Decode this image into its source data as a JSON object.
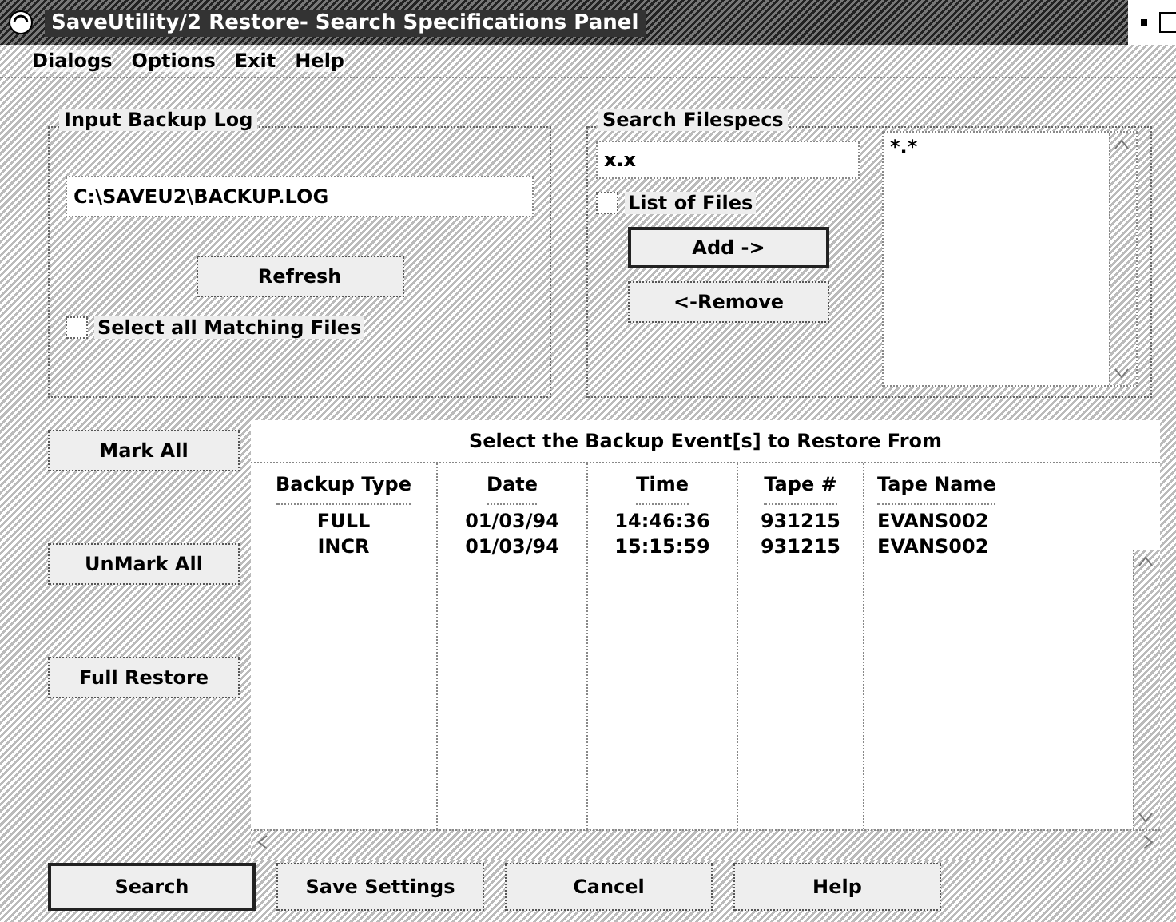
{
  "window": {
    "title": "SaveUtility/2 Restore- Search Specifications Panel"
  },
  "menu": [
    {
      "label": "Dialogs"
    },
    {
      "label": "Options"
    },
    {
      "label": "Exit"
    },
    {
      "label": "Help"
    }
  ],
  "input_backup_log": {
    "title": "Input Backup Log",
    "value": "C:\\SAVEU2\\BACKUP.LOG",
    "refresh_button": "Refresh",
    "select_all": {
      "label": "Select all Matching Files",
      "checked": false
    }
  },
  "search_filespecs": {
    "title": "Search Filespecs",
    "value": "x.x",
    "list_of_files": {
      "label": "List of Files",
      "checked": false
    },
    "add_button": "Add ->",
    "remove_button": "<-Remove",
    "list_items": [
      "*.*"
    ]
  },
  "side_buttons": [
    "Mark All",
    "UnMark All",
    "Full Restore"
  ],
  "table": {
    "title": "Select the Backup Event[s] to Restore From",
    "columns": [
      "Backup Type",
      "Date",
      "Time",
      "Tape #",
      "Tape Name"
    ],
    "rows": [
      [
        "FULL",
        "01/03/94",
        "14:46:36",
        "931215",
        "EVANS002"
      ],
      [
        "INCR",
        "01/03/94",
        "15:15:59",
        "931215",
        "EVANS002"
      ]
    ]
  },
  "bottom_buttons": [
    {
      "label": "Search",
      "default": true
    },
    {
      "label": "Save Settings",
      "default": false
    },
    {
      "label": "Cancel",
      "default": false
    },
    {
      "label": "Help",
      "default": false
    }
  ]
}
